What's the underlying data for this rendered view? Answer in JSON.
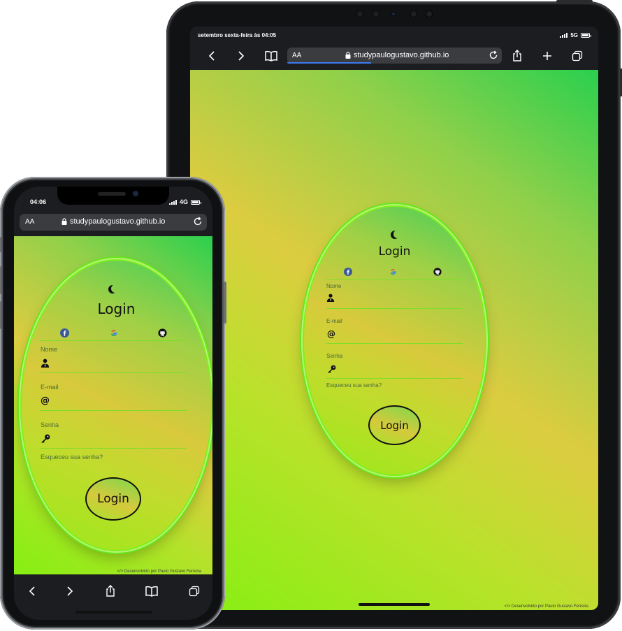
{
  "tablet": {
    "status_time": "setembro sexta-feira às 04:05",
    "network": "5G",
    "url_aa": "AA",
    "url": "studypaulogustavo.github.io",
    "footer_prefix": "</> Desenvolvido por",
    "footer_author": "Paulo Gustavo Ferreira"
  },
  "phone": {
    "status_time": "04:06",
    "network": "4G",
    "url_aa": "AA",
    "url": "studypaulogustavo.github.io",
    "footer_prefix": "</> Desenvolvido por",
    "footer_author": "Paulo Gustavo Ferreira"
  },
  "login": {
    "title": "Login",
    "name_label": "Nome",
    "email_label": "E-mail",
    "email_icon": "@",
    "password_label": "Senha",
    "forgot": "Esqueceu sua senha?",
    "button": "Login"
  },
  "icons": {
    "theme": "moon-icon",
    "social": [
      "facebook-icon",
      "google-icon",
      "github-icon"
    ],
    "fields": [
      "user-icon",
      "at-icon",
      "key-icon"
    ]
  },
  "colors": {
    "gradient_green": "#2ad04e",
    "gradient_yellow": "#dccc40",
    "gradient_lime": "#86ef12",
    "oval_border": "#7ff01a",
    "browser_bar": "#1c1d20",
    "url_field": "#3a3c40",
    "facebook": "#3b5998"
  }
}
